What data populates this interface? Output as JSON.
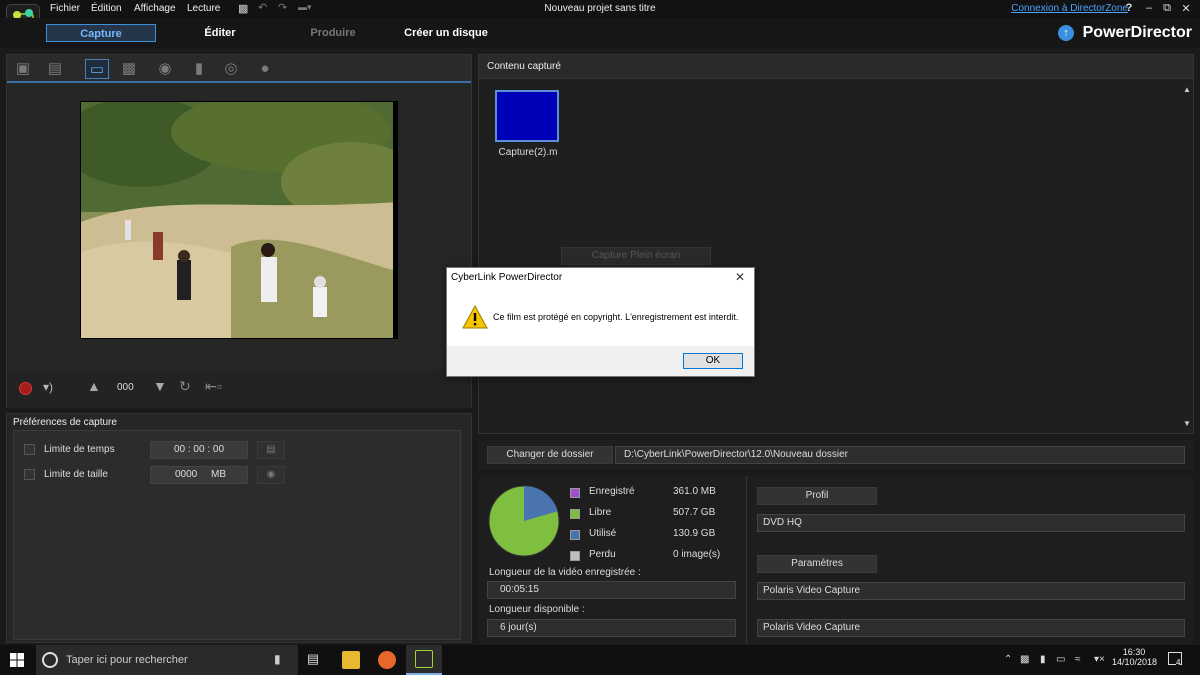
{
  "window": {
    "title": "Nouveau projet sans titre",
    "menu": [
      "Fichier",
      "Édition",
      "Affichage",
      "Lecture"
    ],
    "directorzone_link": "Connexion à DirectorZone",
    "help": "?",
    "brand": "PowerDirector"
  },
  "modes": {
    "capture": "Capture",
    "edit": "Éditer",
    "produce": "Produire",
    "disc": "Créer un disque"
  },
  "devices": [
    "dv-camcorder-icon",
    "hdv-camcorder-icon",
    "tv-icon",
    "digital-tv-icon",
    "webcam-icon",
    "microphone-icon",
    "cd-icon",
    "camcorder-icon"
  ],
  "controls": {
    "counter": "000"
  },
  "preferences": {
    "title": "Préférences de capture",
    "time_limit": {
      "label": "Limite de temps",
      "value": "00 : 00 : 00"
    },
    "size_limit": {
      "label": "Limite de taille",
      "value": "0000",
      "unit": "MB"
    }
  },
  "content": {
    "header": "Contenu capturé",
    "thumbnail_label": "Capture(2).m",
    "ghost_button": "Capture Plein écran",
    "thumbnail_color": "#0000b8"
  },
  "folder": {
    "button": "Changer de dossier",
    "path": "D:\\CyberLink\\PowerDirector\\12.0\\Nouveau dossier"
  },
  "storage": {
    "legend": [
      {
        "label": "Enregistré",
        "value": "361.0  MB",
        "color": "#a050c8"
      },
      {
        "label": "Libre",
        "value": "507.7  GB",
        "color": "#7fbf3f"
      },
      {
        "label": "Utilisé",
        "value": "130.9  GB",
        "color": "#4a74b0"
      },
      {
        "label": "Perdu",
        "value": "0 image(s)",
        "color": "#c0c0c0"
      }
    ],
    "pie_fraction_used": 0.205,
    "recorded_length_label": "Longueur de la vidéo enregistrée :",
    "recorded_length": "00:05:15",
    "available_length_label": "Longueur disponible :",
    "available_length": "6 jour(s)"
  },
  "profile": {
    "button": "Profil",
    "value": "DVD HQ"
  },
  "parameters": {
    "button": "Paramètres",
    "value1": "Polaris Video Capture",
    "value2": "Polaris Video Capture"
  },
  "dialog": {
    "title": "CyberLink PowerDirector",
    "message": "Ce film est protégé en copyright. L'enregistrement est interdit.",
    "ok": "OK"
  },
  "taskbar": {
    "search_placeholder": "Taper ici pour rechercher",
    "time": "16:30",
    "date": "14/10/2018",
    "notifications": "4"
  }
}
